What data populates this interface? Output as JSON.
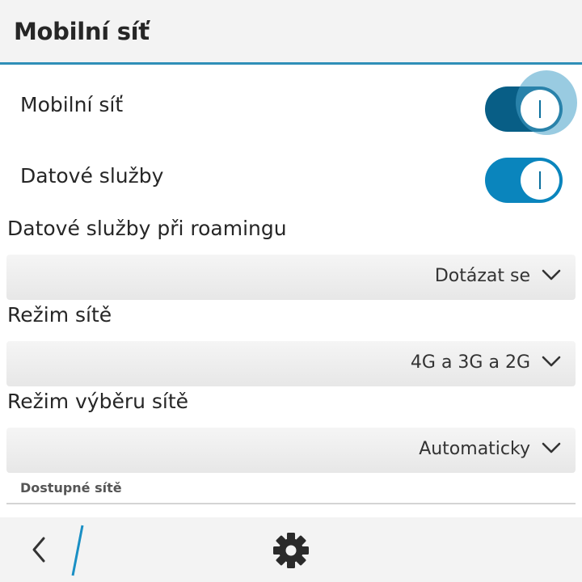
{
  "header": {
    "title": "Mobilní síť"
  },
  "toggles": [
    {
      "label": "Mobilní síť",
      "state": "on"
    },
    {
      "label": "Datové služby",
      "state": "on"
    }
  ],
  "dropdowns": [
    {
      "label": "Datové služby při roamingu",
      "value": "Dotázat se"
    },
    {
      "label": "Režim sítě",
      "value": "4G a 3G a 2G"
    },
    {
      "label": "Režim výběru sítě",
      "value": "Automaticky"
    }
  ],
  "available_networks": {
    "header": "Dostupné sítě"
  },
  "actionbar": {
    "back_icon": "chevron-left-icon",
    "settings_icon": "gear-icon"
  },
  "colors": {
    "accent": "#0a85bd",
    "accent_pressed": "#085e86",
    "header_border": "#2f8fb8"
  }
}
